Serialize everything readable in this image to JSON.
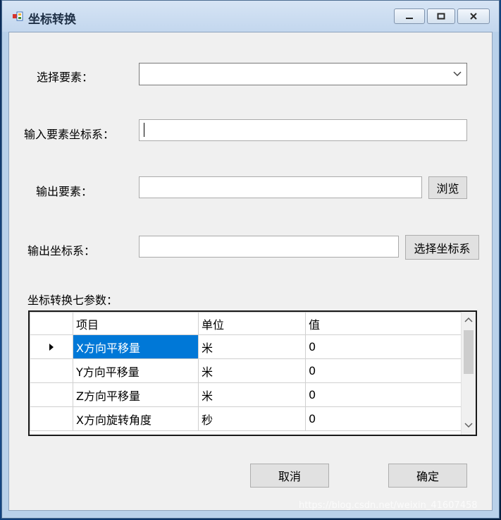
{
  "window": {
    "title": "坐标转换",
    "accent": "#0078d7"
  },
  "form": {
    "select_feature_label": "选择要素：",
    "select_feature_value": "",
    "input_crs_label": "输入要素坐标系：",
    "input_crs_value": "",
    "output_feature_label": "输出要素：",
    "output_feature_value": "",
    "browse_button": "浏览",
    "output_crs_label": "输出坐标系：",
    "output_crs_value": "",
    "select_crs_button": "选择坐标系",
    "params_label": "坐标转换七参数："
  },
  "grid": {
    "columns": [
      "项目",
      "单位",
      "值"
    ],
    "rows": [
      {
        "item": "X方向平移量",
        "unit": "米",
        "value": "0",
        "current": true
      },
      {
        "item": "Y方向平移量",
        "unit": "米",
        "value": "0",
        "current": false
      },
      {
        "item": "Z方向平移量",
        "unit": "米",
        "value": "0",
        "current": false
      },
      {
        "item": "X方向旋转角度",
        "unit": "秒",
        "value": "0",
        "current": false
      }
    ]
  },
  "actions": {
    "cancel": "取消",
    "ok": "确定"
  },
  "watermark": "https://blog.csdn.net/weixin_41607458"
}
